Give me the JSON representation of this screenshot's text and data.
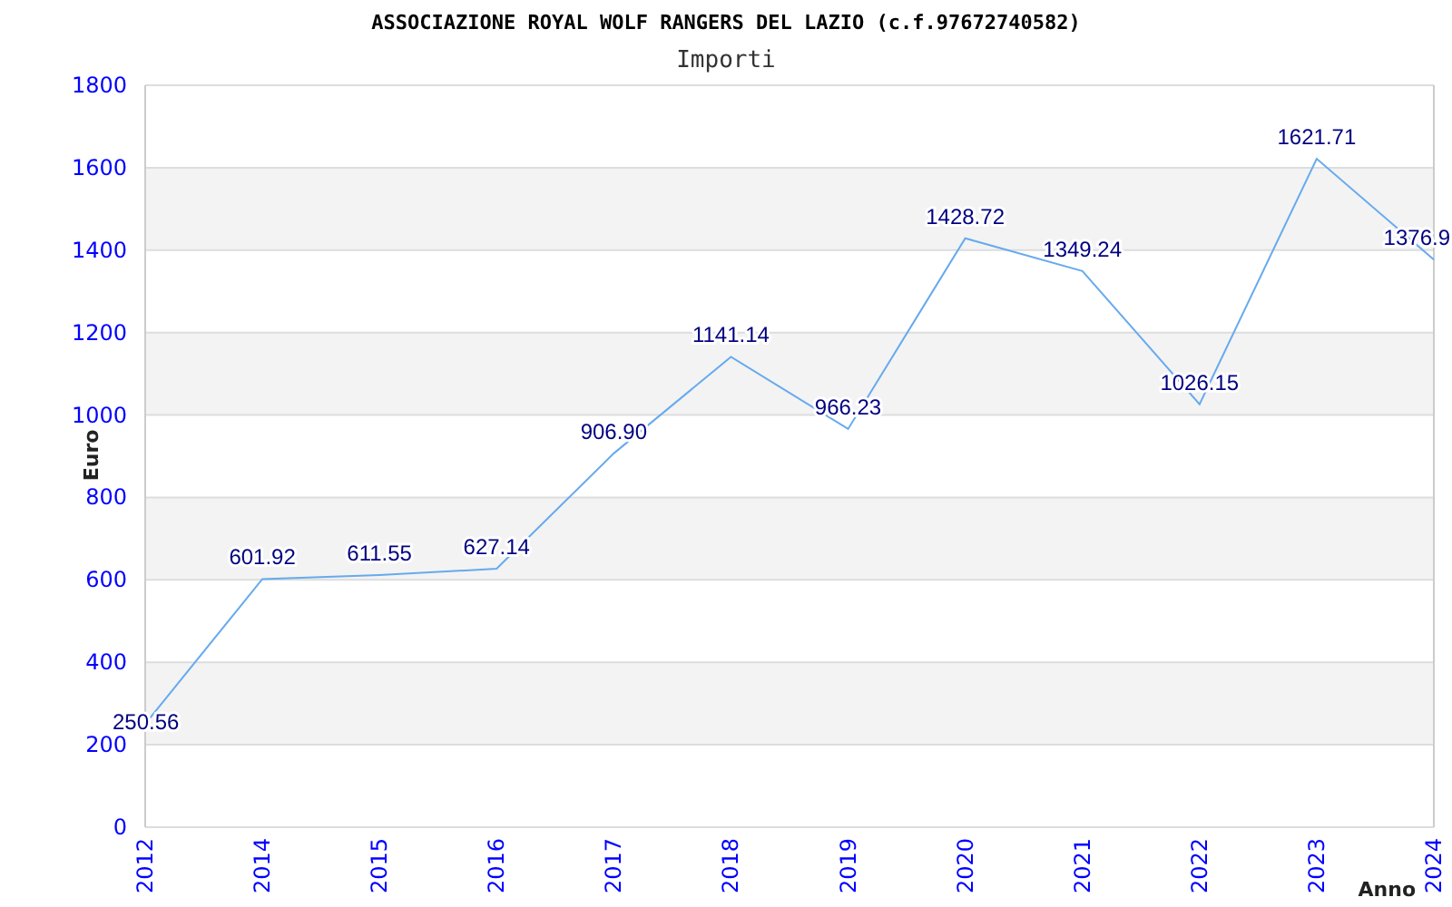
{
  "title": "ASSOCIAZIONE ROYAL WOLF RANGERS DEL LAZIO (c.f.97672740582)",
  "chart_data": {
    "type": "line",
    "grid": true,
    "xlabel": "Anno",
    "ylabel": "Euro",
    "categories": [
      "2012",
      "2014",
      "2015",
      "2016",
      "2017",
      "2018",
      "2019",
      "2020",
      "2021",
      "2022",
      "2023",
      "2024"
    ],
    "series": [
      {
        "name": "Importi",
        "color": "#66aaee",
        "values": [
          250.56,
          601.92,
          611.55,
          627.14,
          906.9,
          1141.14,
          966.23,
          1428.72,
          1349.24,
          1026.15,
          1621.71,
          1376.9
        ]
      }
    ],
    "value_labels": [
      "250.56",
      "601.92",
      "611.55",
      "627.14",
      "906.90",
      "1141.14",
      "966.23",
      "1428.72",
      "1349.24",
      "1026.15",
      "1621.71",
      "1376.9"
    ],
    "ylim": [
      0,
      1800
    ],
    "yticks": [
      0,
      200,
      400,
      600,
      800,
      1000,
      1200,
      1400,
      1600,
      1800
    ]
  }
}
